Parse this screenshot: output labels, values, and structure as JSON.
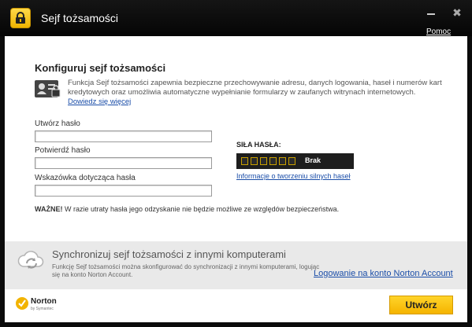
{
  "window": {
    "title": "Sejf tożsamości",
    "help_link": "Pomoc",
    "close_glyph": "✖"
  },
  "form": {
    "heading": "Konfiguruj sejf tożsamości",
    "description": "Funkcja Sejf tożsamości zapewnia bezpieczne przechowywanie adresu, danych logowania, haseł i numerów kart kredytowych oraz umożliwia automatyczne wypełnianie formularzy w zaufanych witrynach internetowych.",
    "learn_more": "Dowiedz się więcej",
    "create_password_label": "Utwórz hasło",
    "create_password_value": "",
    "confirm_password_label": "Potwierdź hasło",
    "confirm_password_value": "",
    "hint_label": "Wskazówka dotycząca hasła",
    "hint_value": "",
    "warning_bold": "WAŻNE!",
    "warning_text": " W razie utraty hasła jego odzyskanie nie będzie możliwe ze względów bezpieczeństwa."
  },
  "strength": {
    "label": "SIŁA HASŁA:",
    "value": "Brak",
    "segments_total": 6,
    "segments_filled": 0,
    "info_link": "Informacje o tworzeniu silnych haseł"
  },
  "sync": {
    "title": "Synchronizuj sejf tożsamości z innymi komputerami",
    "description": "Funkcję Sejf tożsamości można skonfigurować do synchronizacji z innymi komputerami, logując się na konto Norton Account.",
    "login_link": "Logowanie na konto Norton Account"
  },
  "footer": {
    "brand": "Norton",
    "brand_sub": "by Symantec",
    "create_button": "Utwórz"
  },
  "colors": {
    "accent": "#f5b400",
    "link": "#1a4da8",
    "titlebar": "#0b0b0b"
  }
}
